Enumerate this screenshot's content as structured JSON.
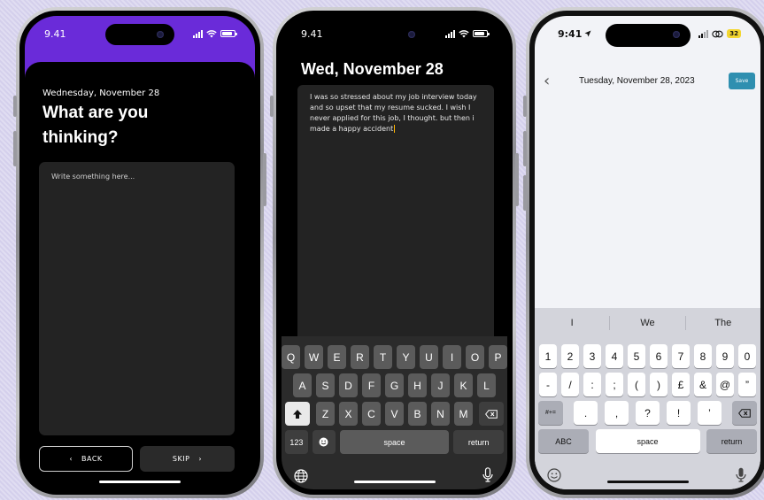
{
  "phone1": {
    "status_time": "9.41",
    "date": "Wednesday, November 28",
    "title": "What are you thinking?",
    "placeholder": "Write something here...",
    "back_label": "BACK",
    "skip_label": "SKIP",
    "colors": {
      "header": "#6a2bd9",
      "background": "#000000",
      "field": "#232323"
    }
  },
  "phone2": {
    "status_time": "9.41",
    "title": "Wed, November 28",
    "entry_text": "I was so stressed about my job interview today and so upset that my resume sucked. I wish I never applied for this job, I thought. but then i made a happy accident",
    "keyboard": {
      "row1": [
        "Q",
        "W",
        "E",
        "R",
        "T",
        "Y",
        "U",
        "I",
        "O",
        "P"
      ],
      "row2": [
        "A",
        "S",
        "D",
        "F",
        "G",
        "H",
        "J",
        "K",
        "L"
      ],
      "row3": [
        "Z",
        "X",
        "C",
        "V",
        "B",
        "N",
        "M"
      ],
      "numbers_key": "123",
      "space_label": "space",
      "return_label": "return"
    }
  },
  "phone3": {
    "status_time": "9:41",
    "battery_level": "32",
    "header_date": "Tuesday, November 28, 2023",
    "save_label": "Save",
    "suggestions": [
      "I",
      "We",
      "The"
    ],
    "keyboard": {
      "row1": [
        "1",
        "2",
        "3",
        "4",
        "5",
        "6",
        "7",
        "8",
        "9",
        "0"
      ],
      "row2": [
        "-",
        "/",
        ":",
        ";",
        "(",
        ")",
        "£",
        "&",
        "@",
        "”"
      ],
      "row3": [
        ".",
        ",",
        "?",
        "!",
        "’"
      ],
      "symbols_key": "#+=",
      "abc_key": "ABC",
      "space_label": "space",
      "return_label": "return"
    },
    "colors": {
      "save_button": "#2f8fb0",
      "background": "#f2f3f7"
    }
  }
}
